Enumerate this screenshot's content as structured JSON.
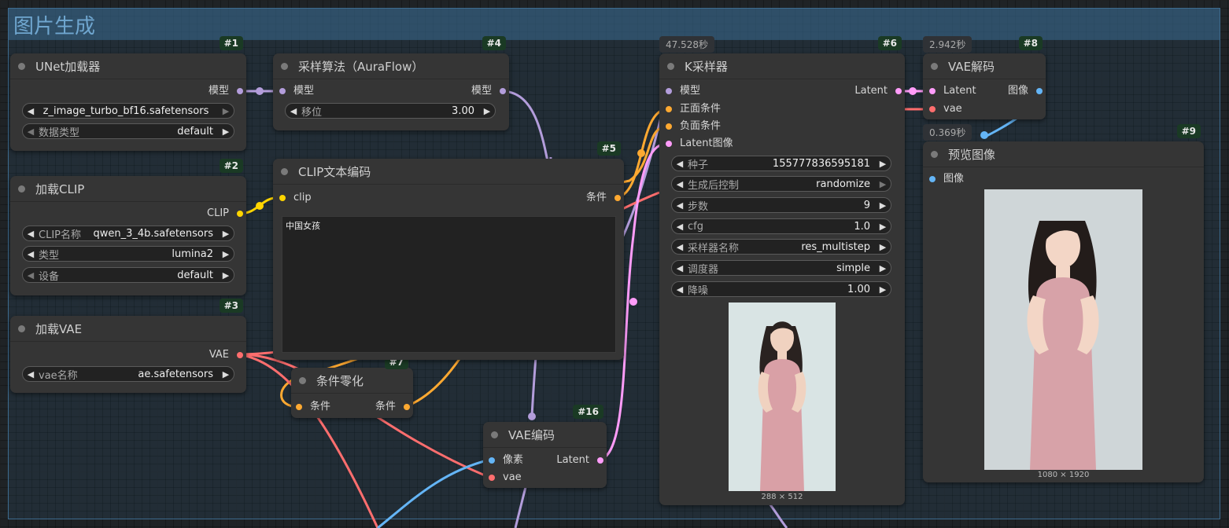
{
  "group": {
    "title": "图片生成"
  },
  "colors": {
    "model": "#b39ddb",
    "clip": "#ffd500",
    "cond": "#ffa931",
    "vae": "#ff6e6e",
    "latent": "#ff9cf9",
    "image": "#64b5f6"
  },
  "nodes": {
    "unet": {
      "id": "#1",
      "title": "UNet加载器",
      "out_model": "模型",
      "w_name": "z_image_turbo_bf16.safetensors",
      "w_dtype_label": "数据类型",
      "w_dtype_value": "default"
    },
    "clip_loader": {
      "id": "#2",
      "title": "加载CLIP",
      "out_clip": "CLIP",
      "w_name_label": "CLIP名称",
      "w_name_value": "qwen_3_4b.safetensors",
      "w_type_label": "类型",
      "w_type_value": "lumina2",
      "w_device_label": "设备",
      "w_device_value": "default"
    },
    "vae_loader": {
      "id": "#3",
      "title": "加载VAE",
      "out_vae": "VAE",
      "w_label": "vae名称",
      "w_value": "ae.safetensors"
    },
    "sampling": {
      "id": "#4",
      "title": "采样算法（AuraFlow）",
      "in_model": "模型",
      "out_model": "模型",
      "w_label": "移位",
      "w_value": "3.00"
    },
    "clip_text": {
      "id": "#5",
      "title": "CLIP文本编码",
      "in_clip": "clip",
      "out_cond": "条件",
      "text": "中国女孩"
    },
    "cond_zero": {
      "id": "#7",
      "title": "条件零化",
      "in_cond": "条件",
      "out_cond": "条件"
    },
    "vae_encode": {
      "id": "#16",
      "title": "VAE编码",
      "in_pixels": "像素",
      "in_vae": "vae",
      "out_latent": "Latent"
    },
    "ksampler": {
      "id": "#6",
      "timer": "47.528秒",
      "title": "K采样器",
      "in_model": "模型",
      "in_pos": "正面条件",
      "in_neg": "负面条件",
      "in_latent": "Latent图像",
      "out_latent": "Latent",
      "widgets": [
        {
          "label": "种子",
          "value": "155777836595181"
        },
        {
          "label": "生成后控制",
          "value": "randomize"
        },
        {
          "label": "步数",
          "value": "9"
        },
        {
          "label": "cfg",
          "value": "1.0"
        },
        {
          "label": "采样器名称",
          "value": "res_multistep"
        },
        {
          "label": "调度器",
          "value": "simple"
        },
        {
          "label": "降噪",
          "value": "1.00"
        }
      ],
      "preview_caption": "288 × 512"
    },
    "vae_decode": {
      "id": "#8",
      "timer": "2.942秒",
      "title": "VAE解码",
      "in_latent": "Latent",
      "in_vae": "vae",
      "out_image": "图像"
    },
    "preview": {
      "id": "#9",
      "timer": "0.369秒",
      "title": "预览图像",
      "in_image": "图像",
      "caption": "1080 × 1920"
    }
  }
}
